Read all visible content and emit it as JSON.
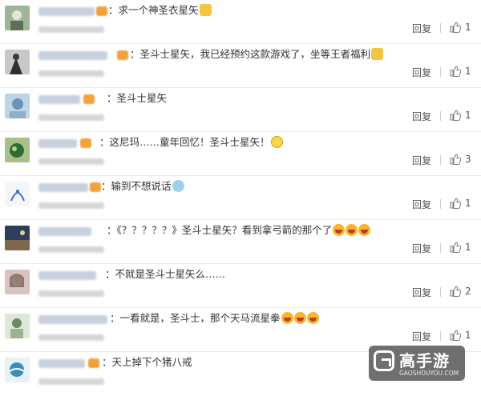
{
  "reply_label": "回复",
  "comments": [
    {
      "text": "：求一个神圣衣星矢",
      "emoji": "cat-face-icon",
      "likes": "1"
    },
    {
      "text": "：圣斗士星矢，我已经预约这款游戏了，坐等王者福利",
      "emoji": "cat-face-icon",
      "likes": "1"
    },
    {
      "text": "：圣斗士星矢",
      "emoji": "",
      "likes": "1"
    },
    {
      "text": "：这尼玛……童年回忆！圣斗士星矢！",
      "emoji": "sad-face-icon",
      "likes": "3"
    },
    {
      "text": "：输到不想说话",
      "emoji": "crying-face-icon",
      "likes": "1"
    },
    {
      "text": "：《？？？？？》圣斗士星矢？看到拿弓箭的那个了",
      "emoji": "grin-face-icon",
      "likes": "1"
    },
    {
      "text": "：不就是圣斗士星矢么……",
      "emoji": "",
      "likes": "2"
    },
    {
      "text": "：一看就是，圣斗士，那个天马流星拳",
      "emoji": "grin-face-icon",
      "likes": "1"
    },
    {
      "text": "：天上掉下个猪八戒",
      "emoji": "",
      "likes": ""
    }
  ],
  "watermark": {
    "title": "高手游",
    "url": "GAOSHOUYOU.COM"
  },
  "colors": {
    "accent": "#f1a23a",
    "text": "#333333",
    "divider": "#ececec"
  }
}
